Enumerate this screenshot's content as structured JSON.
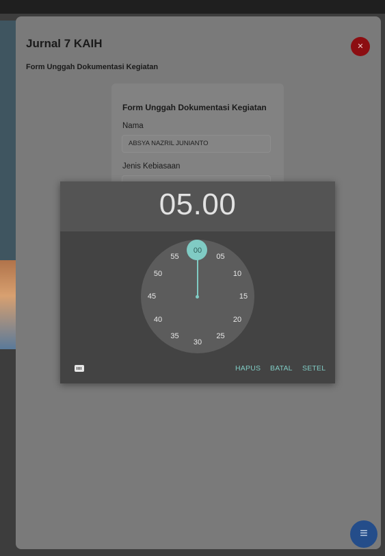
{
  "modal": {
    "title": "Jurnal 7 KAIH",
    "subtitle": "Form Unggah Dokumentasi Kegiatan",
    "close_icon": "close-icon"
  },
  "form": {
    "heading": "Form Unggah Dokumentasi Kegiatan",
    "name_label": "Nama",
    "name_value": "ABSYA NAZRIL JUNIANTO",
    "habit_label": "Jenis Kebiasaan"
  },
  "time_picker": {
    "time": "05.00",
    "selected_minute": "00",
    "minutes": [
      "00",
      "05",
      "10",
      "15",
      "20",
      "25",
      "30",
      "35",
      "40",
      "45",
      "50",
      "55"
    ],
    "keyboard_icon": "keyboard-icon",
    "buttons": {
      "clear": "HAPUS",
      "cancel": "BATAL",
      "set": "SETEL"
    },
    "accent_color": "#80cbc4"
  },
  "fab": {
    "icon": "menu-icon"
  }
}
